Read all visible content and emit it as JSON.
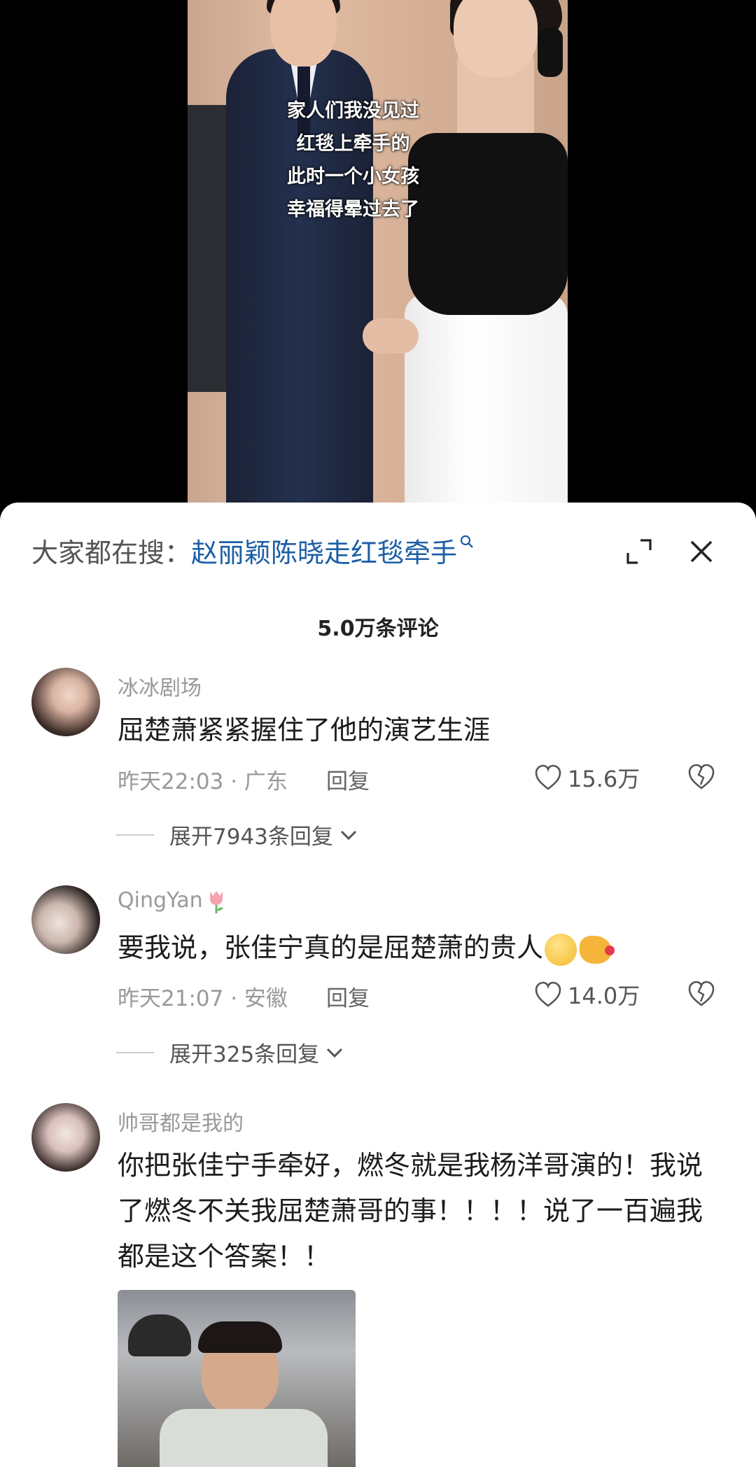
{
  "video": {
    "caption_lines": [
      "家人们我没见过",
      "红毯上牵手的",
      "此时一个小女孩",
      "幸福得晕过去了"
    ]
  },
  "search": {
    "prefix": "大家都在搜：",
    "term": "赵丽颖陈晓走红毯牵手"
  },
  "comments_header": {
    "count_label": "5.0万条评论"
  },
  "comments": [
    {
      "username": "冰冰剧场",
      "text": "屈楚萧紧紧握住了他的演艺生涯",
      "time_location": "昨天22:03 · 广东",
      "reply_label": "回复",
      "likes": "15.6万",
      "expand_label": "展开7943条回复"
    },
    {
      "username": "QingYan",
      "text": "要我说，张佳宁真的是屈楚萧的贵人",
      "time_location": "昨天21:07 · 安徽",
      "reply_label": "回复",
      "likes": "14.0万",
      "expand_label": "展开325条回复"
    },
    {
      "username": "帅哥都是我的",
      "text": "你把张佳宁手牵好，燃冬就是我杨洋哥演的！我说了燃冬不关我屈楚萧哥的事！！！！说了一百遍我都是这个答案！！"
    }
  ],
  "colors": {
    "search_term": "#1b5ea6",
    "muted_text": "#999999",
    "body_text": "#1c1c1c"
  },
  "icons": [
    "search-icon",
    "expand-icon",
    "close-icon",
    "heart-icon",
    "broken-heart-icon",
    "chevron-down-icon",
    "tulip-icon"
  ]
}
